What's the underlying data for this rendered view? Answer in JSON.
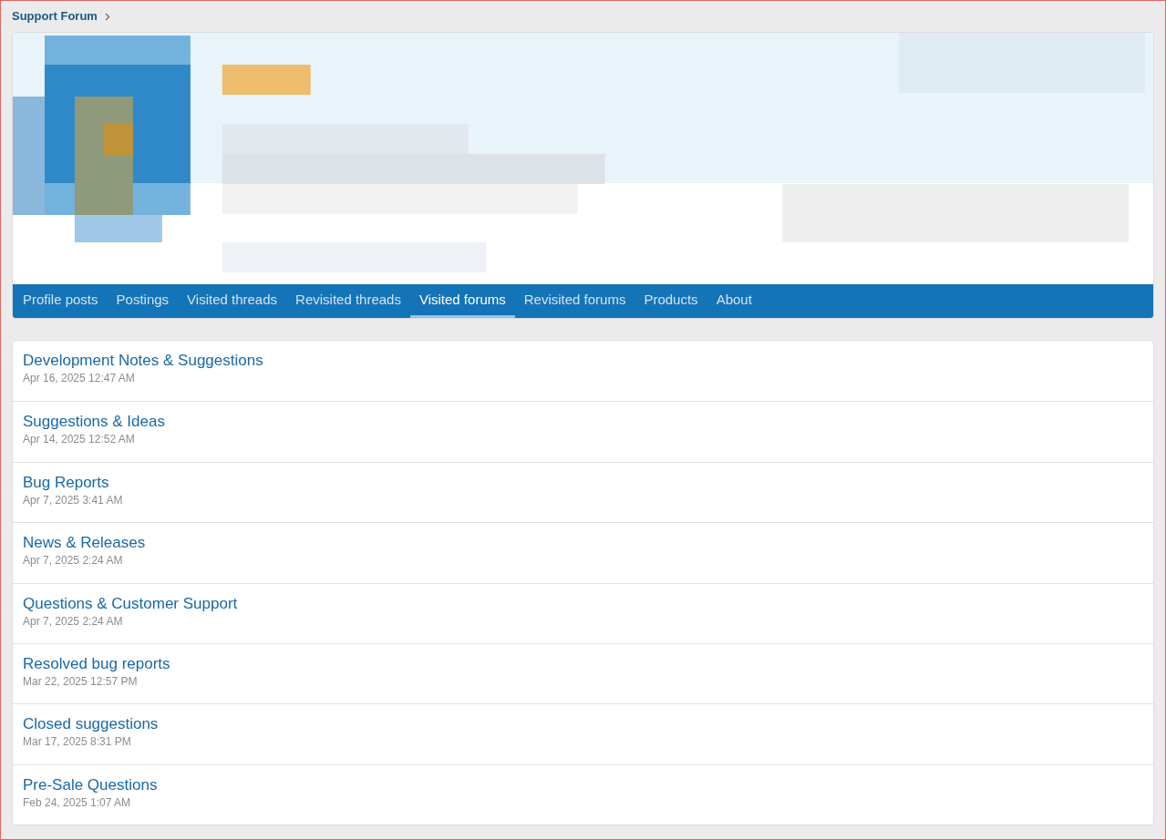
{
  "breadcrumb": {
    "label": "Support Forum"
  },
  "tabs": [
    {
      "label": "Profile posts",
      "selected": false
    },
    {
      "label": "Postings",
      "selected": false
    },
    {
      "label": "Visited threads",
      "selected": false
    },
    {
      "label": "Revisited threads",
      "selected": false
    },
    {
      "label": "Visited forums",
      "selected": true
    },
    {
      "label": "Revisited forums",
      "selected": false
    },
    {
      "label": "Products",
      "selected": false
    },
    {
      "label": "About",
      "selected": false
    }
  ],
  "forums": [
    {
      "title": "Development Notes & Suggestions",
      "date": "Apr 16, 2025 12:47 AM"
    },
    {
      "title": "Suggestions & Ideas",
      "date": "Apr 14, 2025 12:52 AM"
    },
    {
      "title": "Bug Reports",
      "date": "Apr 7, 2025 3:41 AM"
    },
    {
      "title": "News & Releases",
      "date": "Apr 7, 2025 2:24 AM"
    },
    {
      "title": "Questions & Customer Support",
      "date": "Apr 7, 2025 2:24 AM"
    },
    {
      "title": "Resolved bug reports",
      "date": "Mar 22, 2025 12:57 PM"
    },
    {
      "title": "Closed suggestions",
      "date": "Mar 17, 2025 8:31 PM"
    },
    {
      "title": "Pre-Sale Questions",
      "date": "Feb 24, 2025 1:07 AM"
    }
  ]
}
